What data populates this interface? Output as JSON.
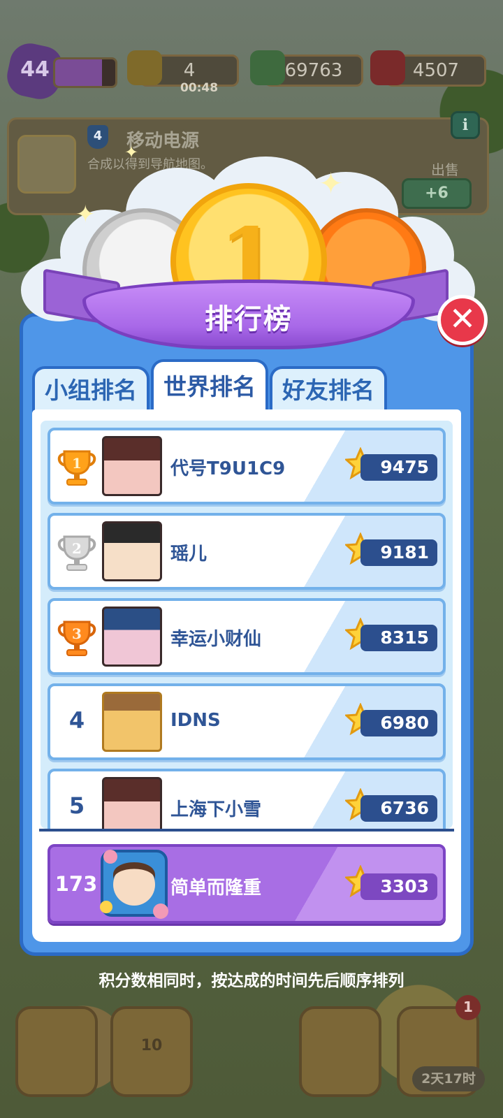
{
  "hud": {
    "level": "44",
    "xp_progress": 0.78,
    "energy": "4",
    "energy_timer": "00:48",
    "cash": "69763",
    "gems": "4507"
  },
  "task": {
    "badge": "4",
    "title": "移动电源",
    "desc": "合成以得到导航地图。",
    "sell_label": "出售",
    "sell_value": "+6",
    "info_label": "i"
  },
  "leaderboard": {
    "title": "排行榜",
    "close_label": "✕",
    "tabs": [
      {
        "label": "小组排名"
      },
      {
        "label": "世界排名"
      },
      {
        "label": "好友排名"
      }
    ],
    "active_tab": "世界排名",
    "rows": [
      {
        "rank": "1",
        "name": "代号T9U1C9",
        "score": "9475"
      },
      {
        "rank": "2",
        "name": "瑶儿",
        "score": "9181"
      },
      {
        "rank": "3",
        "name": "幸运小财仙",
        "score": "8315"
      },
      {
        "rank": "4",
        "name": "IDNS",
        "score": "6980"
      },
      {
        "rank": "5",
        "name": "上海下小雪",
        "score": "6736"
      }
    ],
    "self": {
      "rank": "173",
      "name": "简单而隆重",
      "score": "3303"
    },
    "footnote": "积分数相同时，按达成的时间先后顺序排列"
  },
  "bottom_bar": {
    "trophy_count": "10",
    "notification_count": "1",
    "timer": "2天17时"
  },
  "colors": {
    "modal_blue": "#4f96e8",
    "ribbon_purple": "#a868e8",
    "close_red": "#e8384a",
    "text_blue": "#2f5596",
    "gold": "#ffc320",
    "silver": "#cfcfcf",
    "bronze": "#ff7a14"
  }
}
